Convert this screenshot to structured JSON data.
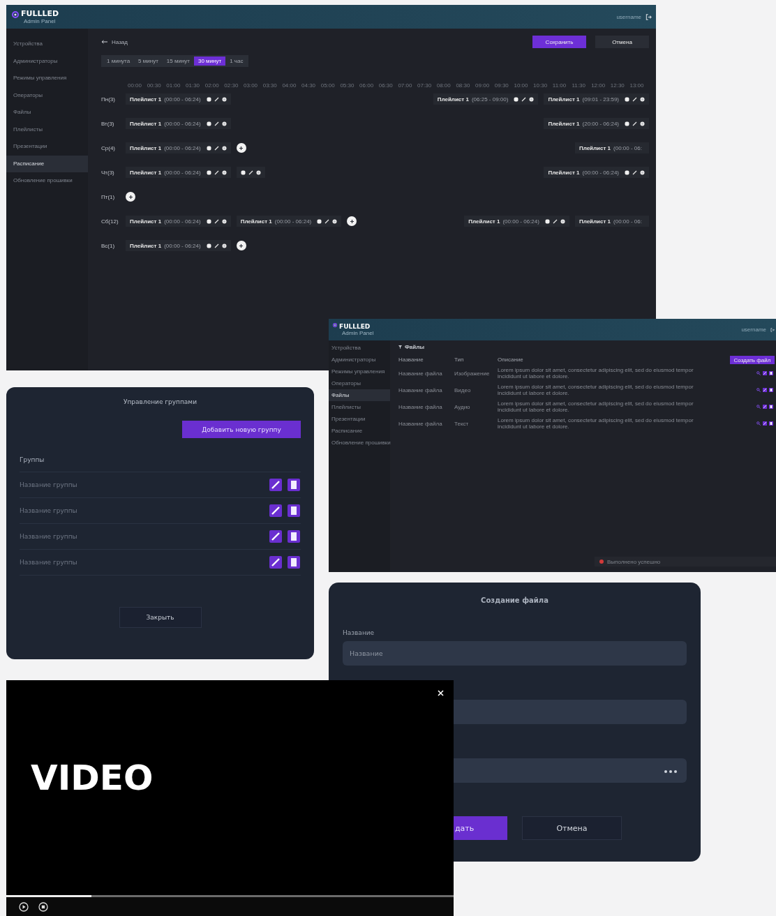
{
  "schedule_app": {
    "brand": {
      "name": "FULLLED",
      "subtitle": "Admin Panel"
    },
    "user": "username",
    "sidebar": {
      "items": [
        {
          "label": "Устройства",
          "selected": false
        },
        {
          "label": "Администраторы",
          "selected": false
        },
        {
          "label": "Режимы управления",
          "selected": false
        },
        {
          "label": "Операторы",
          "selected": false
        },
        {
          "label": "Файлы",
          "selected": false
        },
        {
          "label": "Плейлисты",
          "selected": false
        },
        {
          "label": "Презентации",
          "selected": false
        },
        {
          "label": "Расписание",
          "selected": true
        },
        {
          "label": "Обновление прошивки",
          "selected": false
        }
      ]
    },
    "back": "Назад",
    "save": "Сохранить",
    "cancel": "Отмена",
    "intervals": [
      {
        "label": "1 минута",
        "selected": false
      },
      {
        "label": "5 минут",
        "selected": false
      },
      {
        "label": "15 минут",
        "selected": false
      },
      {
        "label": "30 минут",
        "selected": true
      },
      {
        "label": "1 час",
        "selected": false
      }
    ],
    "ticks": [
      "00:00",
      "00:30",
      "01:00",
      "01:30",
      "02:00",
      "02:30",
      "03:00",
      "03:30",
      "04:00",
      "04:30",
      "05:00",
      "05:30",
      "06:00",
      "06:30",
      "07:00",
      "07:30",
      "08:00",
      "08:30",
      "09:00",
      "09:30",
      "10:00",
      "10:30",
      "11:00",
      "11:30",
      "12:00",
      "12:30",
      "13:00"
    ],
    "days": [
      {
        "label": "Пн(3)",
        "groups": [
          {
            "items": [
              {
                "kind": "entry",
                "label": "Плейлист 1",
                "time": "(00:00 - 06:24)"
              }
            ]
          },
          {
            "items": [
              {
                "kind": "entry",
                "label": "Плейлист 1",
                "time": "(06:25 - 09:00)"
              },
              {
                "kind": "entry",
                "label": "Плейлист 1",
                "time": "(09:01 - 23:59)"
              }
            ]
          }
        ]
      },
      {
        "label": "Вт(3)",
        "groups": [
          {
            "items": [
              {
                "kind": "entry",
                "label": "Плейлист 1",
                "time": "(00:00 - 06:24)"
              }
            ]
          },
          {
            "items": [
              {
                "kind": "entry",
                "label": "Плейлист 1",
                "time": "(20:00 - 06:24)"
              }
            ]
          }
        ]
      },
      {
        "label": "Ср(4)",
        "groups": [
          {
            "items": [
              {
                "kind": "entry",
                "label": "Плейлист 1",
                "time": "(00:00 - 06:24)"
              },
              {
                "kind": "add"
              }
            ]
          },
          {
            "items": [
              {
                "kind": "clipped",
                "label": "Плейлист 1",
                "time": "(00:00 - 06:"
              }
            ]
          }
        ]
      },
      {
        "label": "Чт(3)",
        "groups": [
          {
            "items": [
              {
                "kind": "entry",
                "label": "Плейлист 1",
                "time": "(00:00 - 06:24)"
              },
              {
                "kind": "controls"
              }
            ]
          },
          {
            "items": [
              {
                "kind": "entry",
                "label": "Плейлист 1",
                "time": "(00:00 - 06:24)"
              }
            ]
          }
        ]
      },
      {
        "label": "Пт(1)",
        "groups": [
          {
            "items": [
              {
                "kind": "add"
              }
            ]
          }
        ]
      },
      {
        "label": "Сб(12)",
        "groups": [
          {
            "items": [
              {
                "kind": "entry",
                "label": "Плейлист 1",
                "time": "(00:00 - 06:24)"
              },
              {
                "kind": "entry",
                "label": "Плейлист 1",
                "time": "(00:00 - 06:24)"
              },
              {
                "kind": "add"
              }
            ]
          },
          {
            "items": [
              {
                "kind": "entry",
                "label": "Плейлист 1",
                "time": "(00:00 - 06:24)"
              },
              {
                "kind": "clipped",
                "label": "Плейлист 1",
                "time": "(00:00 - 06:"
              }
            ]
          }
        ]
      },
      {
        "label": "Вс(1)",
        "groups": [
          {
            "items": [
              {
                "kind": "entry",
                "label": "Плейлист 1",
                "time": "(00:00 - 06:24)"
              },
              {
                "kind": "add"
              }
            ]
          }
        ]
      }
    ]
  },
  "files_app": {
    "brand": {
      "name": "FULLLED",
      "subtitle": "Admin Panel"
    },
    "user": "username",
    "sidebar": {
      "items": [
        {
          "label": "Устройства",
          "selected": false
        },
        {
          "label": "Администраторы",
          "selected": false
        },
        {
          "label": "Режимы управления",
          "selected": false
        },
        {
          "label": "Операторы",
          "selected": false
        },
        {
          "label": "Файлы",
          "selected": true
        },
        {
          "label": "Плейлисты",
          "selected": false
        },
        {
          "label": "Презентации",
          "selected": false
        },
        {
          "label": "Расписание",
          "selected": false
        },
        {
          "label": "Обновление прошивки",
          "selected": false
        }
      ]
    },
    "title": "Файлы",
    "columns": [
      "Название",
      "Тип",
      "Описание"
    ],
    "create": "Создать файл",
    "rows": [
      {
        "name": "Название файла",
        "type": "Изображение",
        "description": "Lorem ipsum dolor sit amet, consectetur adipiscing elit, sed do eiusmod tempor incididunt ut labore et dolore."
      },
      {
        "name": "Название файла",
        "type": "Видео",
        "description": "Lorem ipsum dolor sit amet, consectetur adipiscing elit, sed do eiusmod tempor incididunt ut labore et dolore."
      },
      {
        "name": "Название файла",
        "type": "Аудио",
        "description": "Lorem ipsum dolor sit amet, consectetur adipiscing elit, sed do eiusmod tempor incididunt ut labore et dolore."
      },
      {
        "name": "Название файла",
        "type": "Текст",
        "description": "Lorem ipsum dolor sit amet, consectetur adipiscing elit, sed do eiusmod tempor incididunt ut labore et dolore."
      }
    ],
    "toast": "Выполнено успешно"
  },
  "groups_modal": {
    "title": "Управление группами",
    "add": "Добавить новую группу",
    "section": "Группы",
    "groups": [
      "Название группы",
      "Название группы",
      "Название группы",
      "Название группы"
    ],
    "close": "Закрыть"
  },
  "file_dialog": {
    "title": "Создание файла",
    "fields": [
      {
        "label": "Название",
        "placeholder": "Название",
        "kind": "text"
      },
      {
        "kind": "text"
      },
      {
        "kind": "file"
      }
    ],
    "submit": "дать",
    "cancel": "Отмена"
  },
  "video_player": {
    "title": "VIDEO",
    "progress": {
      "level": 0.19
    }
  }
}
